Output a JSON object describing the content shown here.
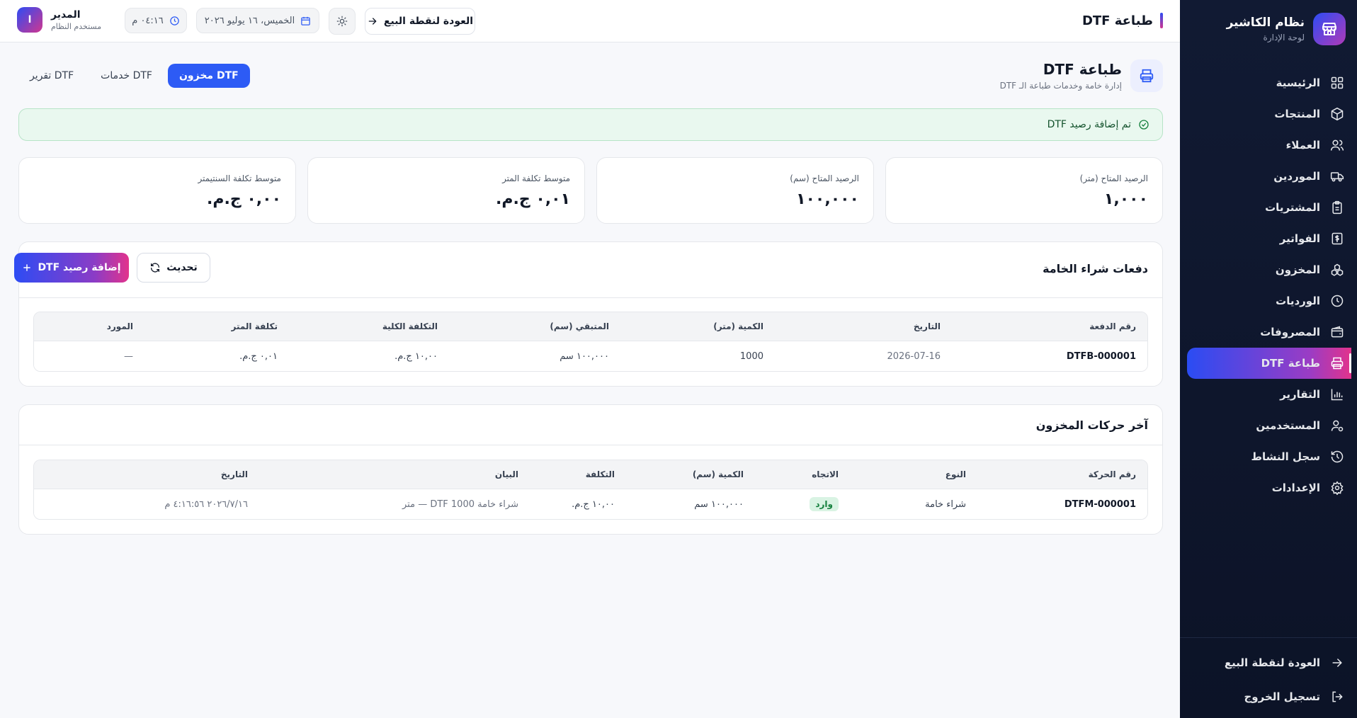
{
  "sidebar": {
    "brand_title": "نظام الكاشير",
    "brand_subtitle": "لوحة الإدارة",
    "items": [
      {
        "label": "الرئيسية",
        "icon": "grid-icon"
      },
      {
        "label": "المنتجات",
        "icon": "box-icon"
      },
      {
        "label": "العملاء",
        "icon": "users-icon"
      },
      {
        "label": "الموردين",
        "icon": "truck-icon"
      },
      {
        "label": "المشتريات",
        "icon": "clipboard-icon"
      },
      {
        "label": "الفواتير",
        "icon": "invoice-icon"
      },
      {
        "label": "المخزون",
        "icon": "stock-icon"
      },
      {
        "label": "الورديات",
        "icon": "clock-icon"
      },
      {
        "label": "المصروفات",
        "icon": "wallet-icon"
      },
      {
        "label": "طباعة DTF",
        "icon": "printer-icon",
        "active": true
      },
      {
        "label": "التقارير",
        "icon": "chart-icon"
      },
      {
        "label": "المستخدمين",
        "icon": "user-cog-icon"
      },
      {
        "label": "سجل النشاط",
        "icon": "history-icon"
      },
      {
        "label": "الإعدادات",
        "icon": "gear-icon"
      }
    ],
    "back_to_pos": "العودة لنقطة البيع",
    "logout": "تسجيل الخروج"
  },
  "topbar": {
    "page_title": "طباعة DTF",
    "back_button": "العودة لنقطة البيع",
    "date": "الخميس، ١٦ يوليو ٢٠٢٦",
    "time": "٠٤:١٦ م",
    "user_name": "المدير",
    "user_role": "مستخدم النظام",
    "avatar_letter": "ا"
  },
  "header": {
    "title": "طباعة DTF",
    "subtitle": "إدارة خامة وخدمات طباعة الـ DTF"
  },
  "tabs": [
    "مخزون DTF",
    "خدمات DTF",
    "تقرير DTF"
  ],
  "alert": "تم إضافة رصيد DTF",
  "stats": [
    {
      "label": "الرصيد المتاح (متر)",
      "value": "١,٠٠٠"
    },
    {
      "label": "الرصيد المتاح (سم)",
      "value": "١٠٠,٠٠٠"
    },
    {
      "label": "متوسط تكلفة المتر",
      "value": "٠,٠١ ج.م."
    },
    {
      "label": "متوسط تكلفة السنتيمتر",
      "value": "٠,٠٠ ج.م."
    }
  ],
  "batches": {
    "title": "دفعات شراء الخامة",
    "refresh_label": "تحديث",
    "add_label": "إضافة رصيد DTF",
    "headers": [
      "رقم الدفعة",
      "التاريخ",
      "الكمية (متر)",
      "المتبقي (سم)",
      "التكلفة الكلية",
      "تكلفة المتر",
      "المورد"
    ],
    "rows": [
      [
        "DTFB-000001",
        "2026-07-16",
        "1000",
        "١٠٠,٠٠٠ سم",
        "١٠,٠٠ ج.م.",
        "٠,٠١ ج.م.",
        "—"
      ]
    ]
  },
  "movements": {
    "title": "آخر حركات المخزون",
    "headers": [
      "رقم الحركة",
      "النوع",
      "الاتجاه",
      "الكمية (سم)",
      "التكلفة",
      "البيان",
      "التاريخ"
    ],
    "rows": [
      [
        "DTFM-000001",
        "شراء خامة",
        "وارد",
        "١٠٠,٠٠٠ سم",
        "١٠,٠٠ ج.م.",
        "شراء خامة 1000 DTF — متر",
        "٢٠٢٦/٧/١٦ ٤:١٦:٥٦ م"
      ]
    ]
  },
  "colors": {
    "accent": "#2d5bf5",
    "sidebar_bg": "#111a33",
    "success_bg": "#e9f8ef"
  }
}
